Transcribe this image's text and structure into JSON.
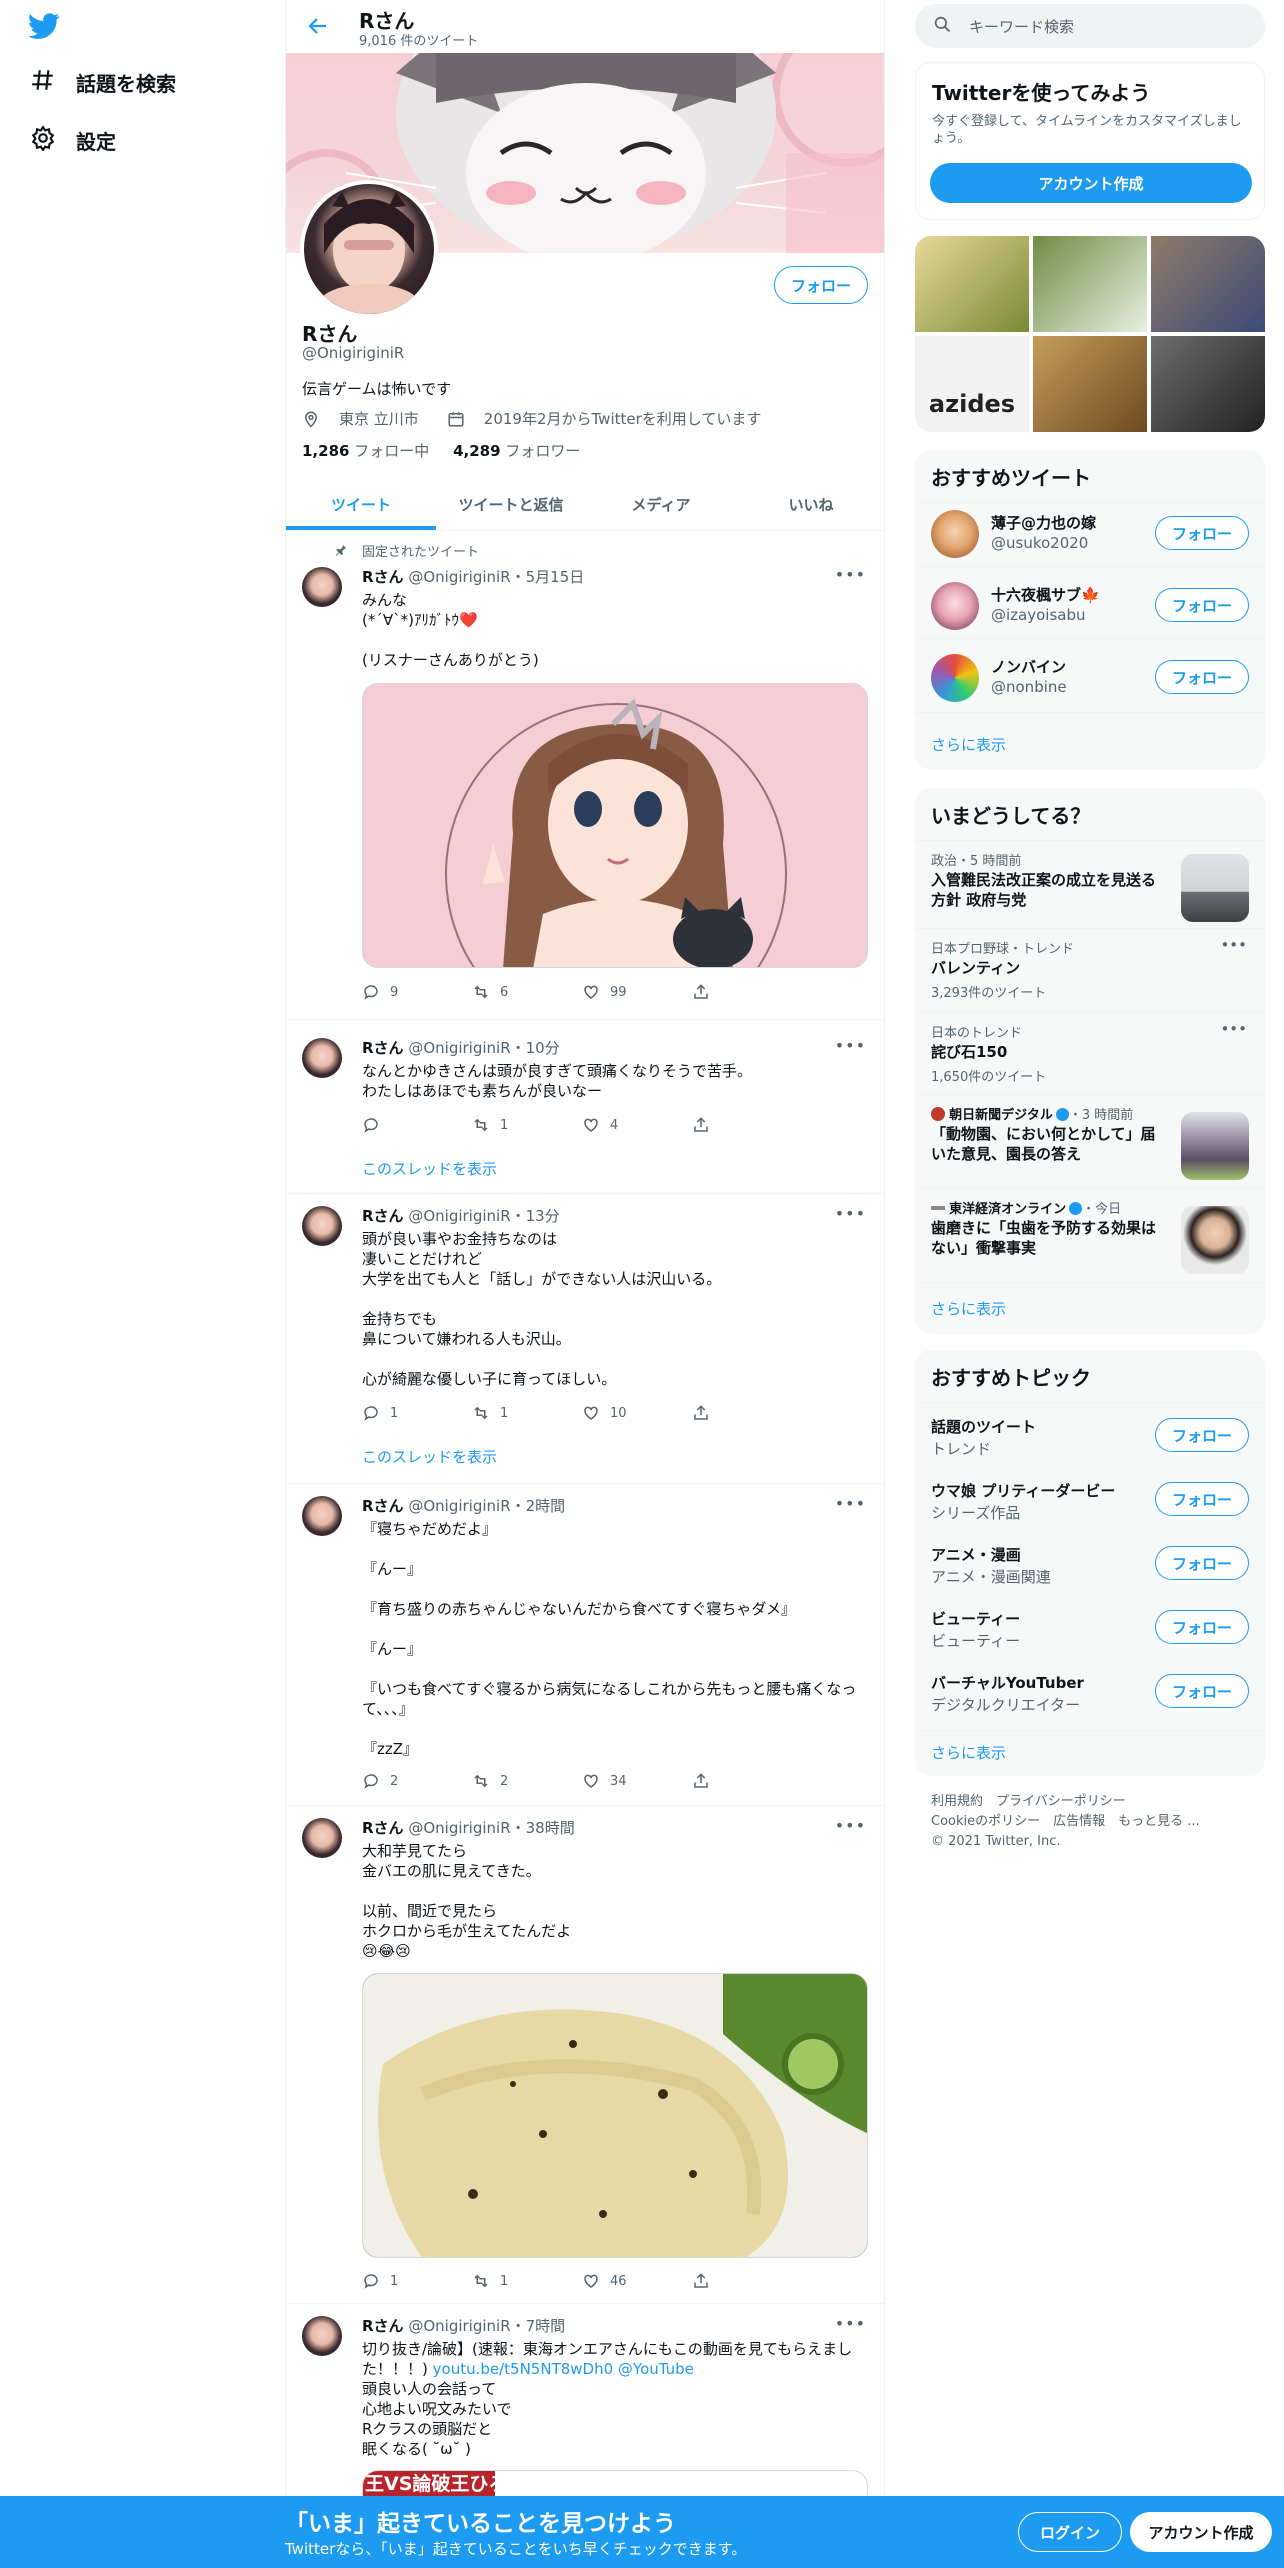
{
  "nav": {
    "logo_icon": "twitter-bird-icon",
    "items": [
      {
        "label": "話題を検索",
        "icon": "hashtag-icon"
      },
      {
        "label": "設定",
        "icon": "gear-icon"
      }
    ]
  },
  "header": {
    "name": "Rさん",
    "tweet_count": "9,016 件のツイート"
  },
  "profile": {
    "name": "Rさん",
    "handle": "@OnigiriginiR",
    "bio": "伝言ゲームは怖いです",
    "location": "東京 立川市",
    "joined": "2019年2月からTwitterを利用しています",
    "following_count": "1,286",
    "following_label": "フォロー中",
    "followers_count": "4,289",
    "followers_label": "フォロワー",
    "follow_button": "フォロー"
  },
  "tabs": [
    "ツイート",
    "ツイートと返信",
    "メディア",
    "いいね"
  ],
  "pinned_label": "固定されたツイート",
  "tweets": [
    {
      "name": "Rさん",
      "meta": "@OnigiriginiR・5月15日",
      "text": "みんな\n(*´∀`*)ｱﾘｶﾞﾄｳ❤️\n\n(リスナーさんありがとう)",
      "reply": "9",
      "retweet": "6",
      "like": "99"
    },
    {
      "name": "Rさん",
      "meta": "@OnigiriginiR・10分",
      "text": "なんとかゆきさんは頭が良すぎて頭痛くなりそうで苦手。\nわたしはあほでも素ちんが良いなー",
      "reply": "",
      "retweet": "1",
      "like": "4",
      "thread": "このスレッドを表示"
    },
    {
      "name": "Rさん",
      "meta": "@OnigiriginiR・13分",
      "text": "頭が良い事やお金持ちなのは\n凄いことだけれど\n大学を出ても人と「話し」ができない人は沢山いる。\n\n金持ちでも\n鼻について嫌われる人も沢山。\n\n心が綺麗な優しい子に育ってほしい。",
      "reply": "1",
      "retweet": "1",
      "like": "10",
      "thread": "このスレッドを表示"
    },
    {
      "name": "Rさん",
      "meta": "@OnigiriginiR・2時間",
      "text": "『寝ちゃだめだよ』\n\n『んー』\n\n『育ち盛りの赤ちゃんじゃないんだから食べてすぐ寝ちゃダメ』\n\n『んー』\n\n『いつも食べてすぐ寝るから病気になるしこれから先もっと腰も痛くなって、、、』\n\n『zzZ』",
      "reply": "2",
      "retweet": "2",
      "like": "34"
    },
    {
      "name": "Rさん",
      "meta": "@OnigiriginiR・38時間",
      "text": "大和芋見てたら\n金バエの肌に見えてきた。\n\n以前、間近で見たら\nホクロから毛が生えてたんだよ\n😢😂😢",
      "reply": "1",
      "retweet": "1",
      "like": "46"
    },
    {
      "name": "Rさん",
      "meta": "@OnigiriginiR・7時間",
      "text_main": "切り抜き/論破】(速報：東海オンエアさんにもこの動画を見てもらえました！！！)",
      "link": "youtu.be/t5N5NT8wDh0 @YouTube",
      "text_rest": "頭良い人の会話って\n心地よい呪文みたいで\nRクラスの頭脳だと\n眠くなる( ˘ω˘ )",
      "media_caption": "王VS論破王ひろ"
    }
  ],
  "right": {
    "search_placeholder": "キーワード検索",
    "try_title": "Twitterを使ってみよう",
    "try_desc": "今すぐ登録して、タイムラインをカスタマイズしましょう。",
    "try_button": "アカウント作成",
    "photo_text": "azides",
    "rec_title": "おすすめツイート",
    "recs": [
      {
        "name": "薄子@力也の嫁",
        "handle": "@usuko2020"
      },
      {
        "name": "十六夜楓サブ🍁",
        "handle": "@izayoisabu"
      },
      {
        "name": "ノンバイン",
        "handle": "@nonbine"
      }
    ],
    "follow_label": "フォロー",
    "show_more": "さらに表示",
    "trend_title": "いまどうしてる？",
    "trends": [
      {
        "meta": "政治・5 時間前",
        "title": "入管難民法改正案の成立を見送る方針 政府与党"
      },
      {
        "meta": "日本プロ野球・トレンド",
        "title": "バレンティン",
        "sub": "3,293件のツイート"
      },
      {
        "meta": "日本のトレンド",
        "title": "詫び石150",
        "sub": "1,650件のツイート"
      },
      {
        "source": "朝日新聞デジタル",
        "time": "・3 時間前",
        "title": "「動物園、におい何とかして」届いた意見、園長の答え"
      },
      {
        "source": "東洋経済オンライン",
        "time": "・今日",
        "title": "歯磨きに「虫歯を予防する効果はない」衝撃事実"
      }
    ],
    "topic_title": "おすすめトピック",
    "topics": [
      {
        "name": "話題のツイート",
        "sub": "トレンド"
      },
      {
        "name": "ウマ娘 プリティーダービー",
        "sub": "シリーズ作品"
      },
      {
        "name": "アニメ・漫画",
        "sub": "アニメ・漫画関連"
      },
      {
        "name": "ビューティー",
        "sub": "ビューティー"
      },
      {
        "name": "バーチャルYouTuber",
        "sub": "デジタルクリエイター"
      }
    ],
    "footer_line1": "利用規約　プライバシーポリシー",
    "footer_line2": "Cookieのポリシー　広告情報　もっと見る ...",
    "footer_line3": "© 2021 Twitter, Inc."
  },
  "bottom": {
    "title": "「いま」起きていることを見つけよう",
    "sub": "Twitterなら、「いま」起きていることをいち早くチェックできます。",
    "login": "ログイン",
    "signup": "アカウント作成"
  },
  "colors": {
    "accent": "#1d9bf0",
    "text": "#0f1419",
    "muted": "#536471"
  }
}
